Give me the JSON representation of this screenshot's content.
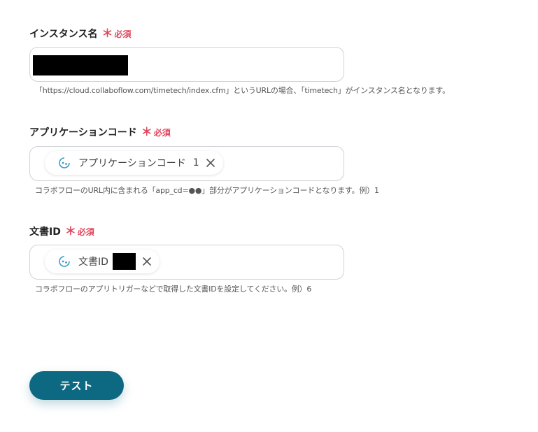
{
  "fields": [
    {
      "label": "インスタンス名",
      "required_star": "＊",
      "required_text": "必須",
      "hint": "「https://cloud.collaboflow.com/timetech/index.cfm」というURLの場合、「timetech」がインスタンス名となります。"
    },
    {
      "label": "アプリケーションコード",
      "required_star": "＊",
      "required_text": "必須",
      "chip_label": "アプリケーションコード",
      "chip_value": "1",
      "hint": "コラボフローのURL内に含まれる「app_cd=●●」部分がアプリケーションコードとなります。例）1"
    },
    {
      "label": "文書ID",
      "required_star": "＊",
      "required_text": "必須",
      "chip_label": "文書ID",
      "hint": "コラボフローのアプリトリガーなどで取得した文書IDを設定してください。例）6"
    }
  ],
  "test_button_label": "テスト",
  "colors": {
    "required": "#e0475b",
    "primary_button": "#0d6882",
    "chip_icon": "#3a9bc4"
  }
}
